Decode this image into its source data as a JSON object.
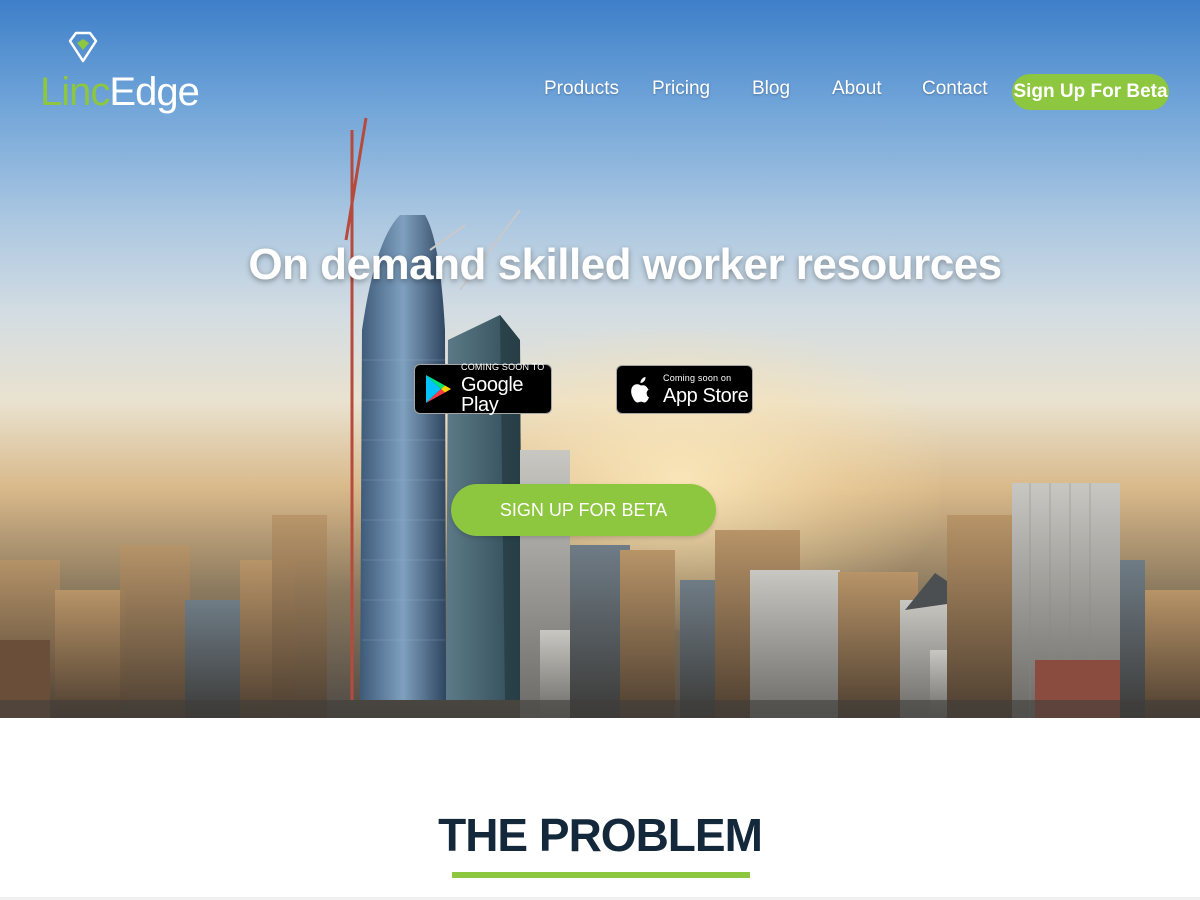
{
  "brand": {
    "name_part1": "Linc",
    "name_part2": "Edge",
    "accent_color": "#8dc63f",
    "dark_color": "#13283a",
    "logo_icon": "map-pin-icon"
  },
  "nav": {
    "links": [
      {
        "label": "Products"
      },
      {
        "label": "Pricing"
      },
      {
        "label": "Blog"
      },
      {
        "label": "About"
      },
      {
        "label": "Contact"
      }
    ],
    "cta_label": "Sign Up For Beta"
  },
  "hero": {
    "headline": "On demand skilled worker resources",
    "google_badge": {
      "small": "COMING SOON TO",
      "big": "Google Play",
      "icon": "google-play-icon"
    },
    "apple_badge": {
      "small": "Coming soon on",
      "big": "App Store",
      "icon": "apple-icon"
    },
    "cta_label": "SIGN UP FOR BETA"
  },
  "problem": {
    "title": "THE PROBLEM"
  }
}
